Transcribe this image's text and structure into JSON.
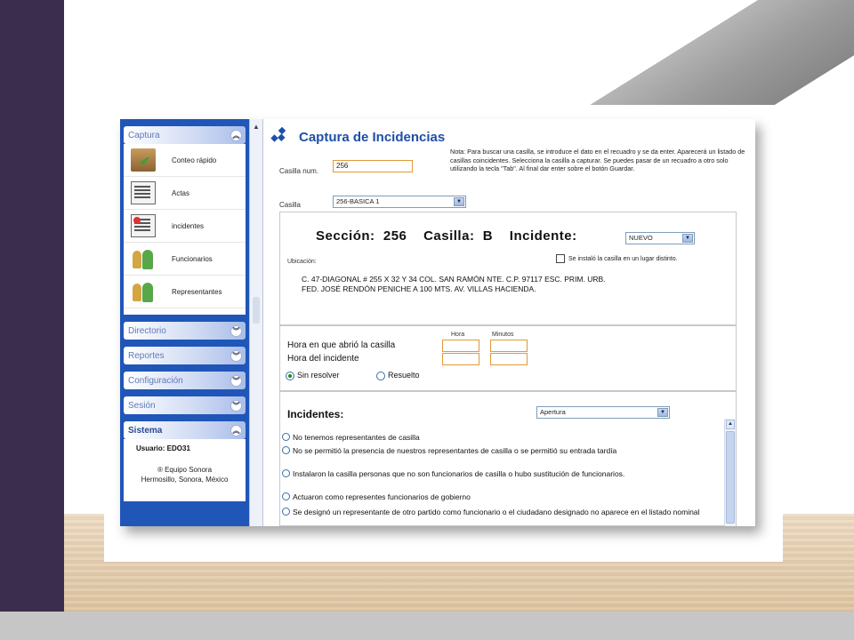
{
  "sidebar": {
    "captura": {
      "title": "Captura",
      "items": [
        {
          "label": "Conteo rápido",
          "icon": "ballot-box-icon"
        },
        {
          "label": "Actas",
          "icon": "document-icon"
        },
        {
          "label": "incidentes",
          "icon": "document-alert-icon"
        },
        {
          "label": "Funcionarios",
          "icon": "people-icon"
        },
        {
          "label": "Representantes",
          "icon": "people-icon"
        }
      ]
    },
    "sections": [
      "Directorio",
      "Reportes",
      "Configuración",
      "Sesión"
    ],
    "sistema": {
      "title": "Sistema",
      "user": "Usuario: EDO31",
      "credit_line1": "® Equipo Sonora",
      "credit_line2": "Hermosillo, Sonora, México"
    }
  },
  "main": {
    "title": "Captura de Incidencias",
    "note": "Nota: Para buscar una casilla, se introduce el dato en el recuadro y se da enter. Aparecerá un listado de casillas coincidentes. Selecciona la casilla a capturar. Se puedes pasar de un recuadro a otro solo utilizando la tecla \"Tab\". Al final dar enter sobre el botón Guardar.",
    "casilla_num_label": "Casilla num.",
    "casilla_num_value": "256",
    "casilla_label": "Casilla",
    "casilla_select": "256-BASICA 1",
    "seccion_label": "Sección:",
    "seccion_value": "256",
    "casilla_tipo_label": "Casilla:",
    "casilla_tipo_value": "B",
    "incidente_label": "Incidente:",
    "incidente_select": "NUEVO",
    "ubicacion_label": "Ubicación:",
    "lugar_distinto_label": "Se instaló la casilla en un lugar distinto.",
    "address_line1": "C. 47-DIAGONAL # 255 X 32 Y 34 COL. SAN RAMÓN NTE. C.P. 97117 ESC. PRIM. URB.",
    "address_line2": "FED. JOSÉ RENDÓN PENICHE A 100 MTS. AV. VILLAS HACIENDA.",
    "hora_head": "Hora",
    "minutos_head": "Minutos",
    "hora_abrio_label": "Hora en que abrió la casilla",
    "hora_incidente_label": "Hora del incidente",
    "sin_resolver_label": "Sin resolver",
    "resuelto_label": "Resuelto",
    "incidentes_label": "Incidentes:",
    "incidentes_select": "Apertura",
    "options": [
      "No tenemos representantes de casilla",
      "No se permitió la presencia de nuestros representantes de casilla o se permitió su entrada tardía",
      "Instalaron la casilla personas que no son funcionarios de casilla o hubo sustitución de funcionarios.",
      "Actuaron como representes funcionarios de gobierno",
      "Se designó un representante de otro partido como funcionario o el ciudadano designado no aparece en el listado nominal"
    ]
  },
  "colors": {
    "sidebar_blue": "#1f56b8",
    "title_blue": "#1e4fa8",
    "input_border_orange": "#e29a37",
    "slide_purple": "#3a2d4d"
  }
}
